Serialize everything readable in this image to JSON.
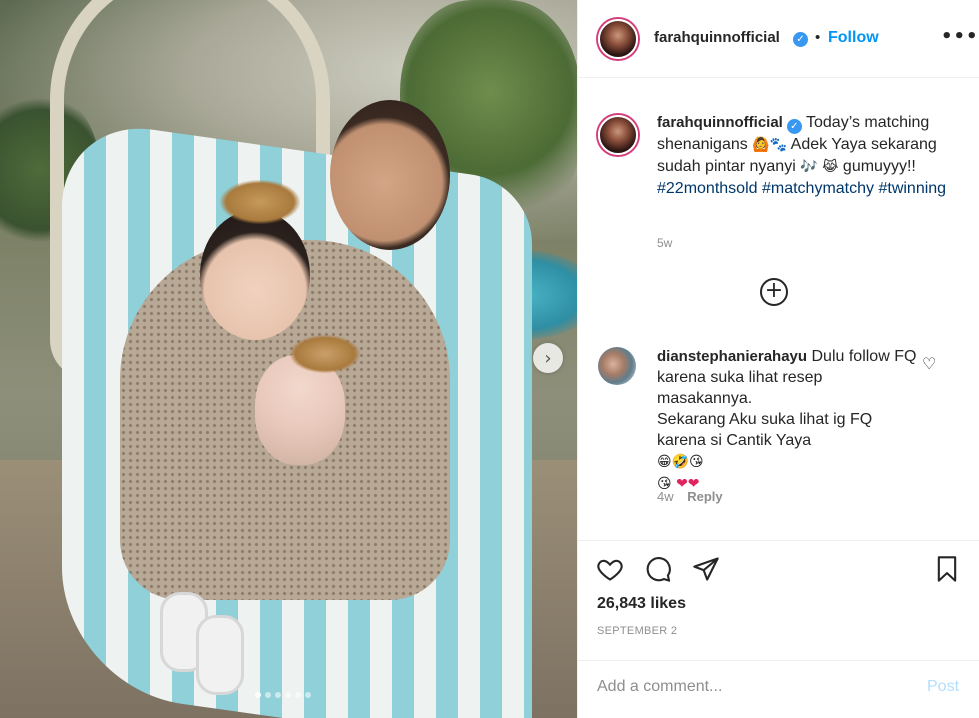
{
  "post": {
    "username": "farahquinnofficial",
    "verified_glyph": "✓",
    "separator": "•",
    "follow_label": "Follow",
    "more_label": "•••",
    "next_label": "›",
    "caption": {
      "text_1": "Today’s matching shenanigans",
      "emoji_1": "🙆🐾",
      "text_2": "Adek Yaya sekarang sudah pintar nyanyi",
      "emoji_2": "🎶",
      "emoji_3": "😹",
      "text_3": "gumuyyy!!",
      "hashtags": [
        "#22monthsold",
        "#matchymatchy",
        "#twinning"
      ],
      "time": "5w"
    },
    "load_more_label": "+",
    "comments": [
      {
        "username": "dianstephanierahayu",
        "line_1": "Dulu follow FQ karena suka lihat resep masakannya.",
        "line_2": "Sekarang Aku suka lihat ig FQ karena si Cantik Yaya",
        "emojis_1": "😁🤣😘",
        "emojis_2": "😘",
        "hearts": "❤❤",
        "heart_glyph": "♡",
        "time": "4w",
        "reply_label": "Reply"
      }
    ],
    "likes": "26,843 likes",
    "date": "SEPTEMBER 2",
    "comment_placeholder": "Add a comment...",
    "post_label": "Post",
    "carousel_total": 6,
    "carousel_active": 1
  },
  "icons": [
    "heart-icon",
    "comment-icon",
    "share-icon",
    "bookmark-icon",
    "verified-badge-icon",
    "more-icon",
    "next-arrow-icon",
    "plus-circle-icon"
  ],
  "colors": {
    "link": "#0095f6",
    "hashtag": "#00376b",
    "muted": "#8e8e8e",
    "verified": "#3897f0",
    "post_disabled": "#b2dffc"
  }
}
